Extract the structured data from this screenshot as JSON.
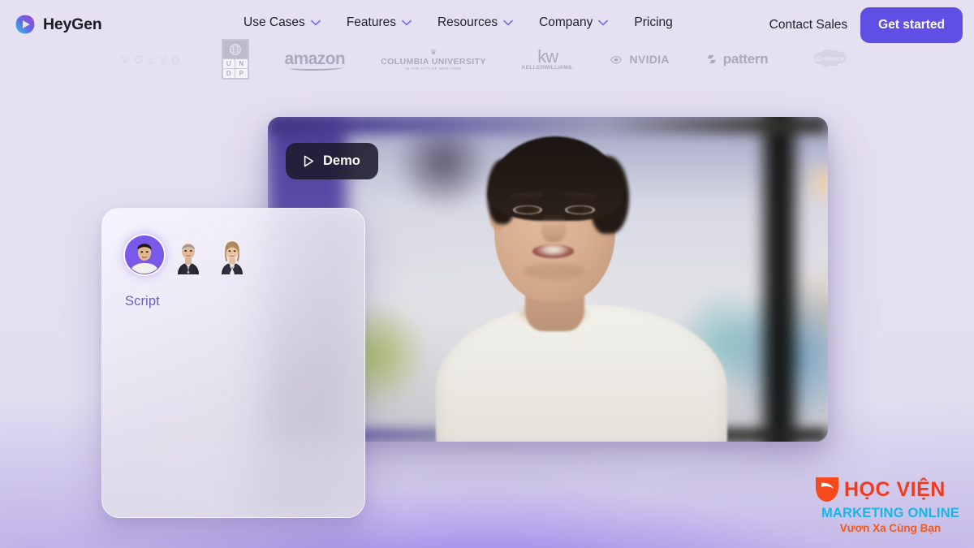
{
  "brand": {
    "name": "HeyGen",
    "logo_icon": "heygen-play-logo",
    "accent_color": "#5f4fe4"
  },
  "nav": {
    "links": [
      {
        "label": "Use Cases",
        "has_dropdown": true
      },
      {
        "label": "Features",
        "has_dropdown": true
      },
      {
        "label": "Resources",
        "has_dropdown": true
      },
      {
        "label": "Company",
        "has_dropdown": true
      },
      {
        "label": "Pricing",
        "has_dropdown": false
      }
    ],
    "contact_sales_label": "Contact Sales",
    "get_started_label": "Get started",
    "dropdown_icon": "chevron-down-icon"
  },
  "logo_strip": {
    "brands": [
      {
        "name": "Volvo",
        "text": "VOLVO"
      },
      {
        "name": "UNDP",
        "text": "UNDP"
      },
      {
        "name": "Amazon",
        "text": "amazon"
      },
      {
        "name": "Columbia University",
        "text": "COLUMBIA UNIVERSITY",
        "subtext": "IN THE CITY OF NEW YORK"
      },
      {
        "name": "Keller Williams",
        "text": "kw",
        "subtext": "KELLERWILLIAMS."
      },
      {
        "name": "NVIDIA",
        "text": "NVIDIA"
      },
      {
        "name": "Pattern",
        "text": "pattern"
      },
      {
        "name": "Salesforce",
        "text": "salesforce"
      }
    ]
  },
  "hero": {
    "video": {
      "demo_chip_label": "Demo",
      "play_icon": "play-triangle-icon",
      "scene_description": "presenter-video-still"
    },
    "script_card": {
      "label": "Script",
      "avatars": [
        {
          "name": "avatar-asian-man",
          "selected": true
        },
        {
          "name": "avatar-older-man-suit",
          "selected": false
        },
        {
          "name": "avatar-woman-blazer",
          "selected": false
        }
      ]
    }
  },
  "watermark": {
    "icon": "play-logo-icon",
    "line1": "HỌC VIỆN",
    "line2": "MARKETING ONLINE",
    "line3": "Vươn Xa Cùng Bạn",
    "color_line1": "#ef3c20",
    "color_line2": "#17b6e8",
    "color_line3": "#ef5a20"
  }
}
